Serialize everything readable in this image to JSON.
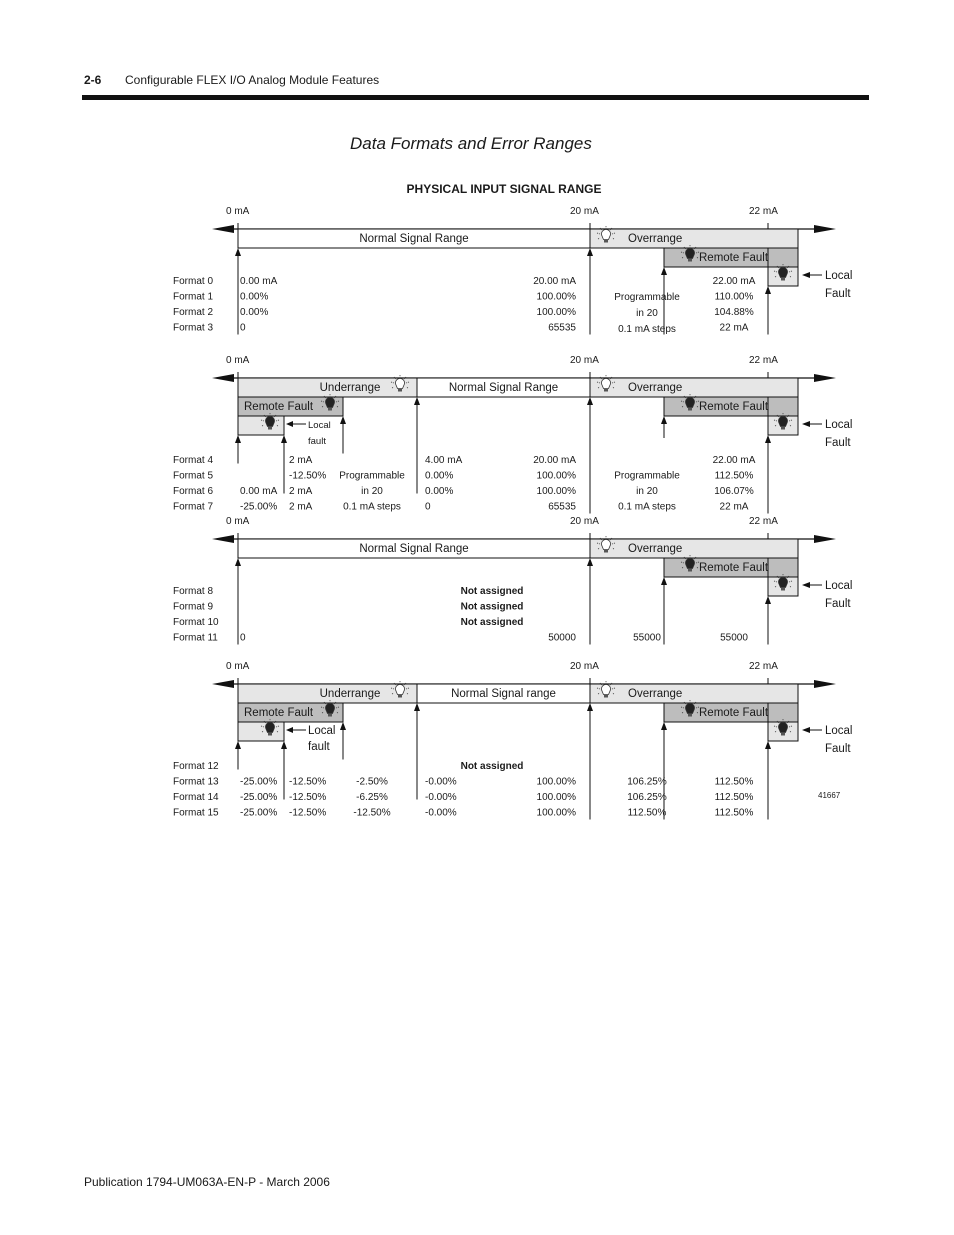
{
  "header": {
    "page_number": "2-6",
    "chapter_title": "Configurable FLEX I/O Analog Module Features"
  },
  "figure": {
    "title": "Data Formats and Error Ranges",
    "subtitle": "PHYSICAL INPUT SIGNAL RANGE",
    "figure_id": "41667"
  },
  "footer": {
    "publication": "Publication 1794-UM063A-EN-P - March 2006"
  },
  "colors": {
    "light_fill": "#e6e6e6",
    "dark_fill": "#bdbdbd",
    "line": "#111111"
  },
  "panels": [
    {
      "axis_labels": [
        "0 mA",
        "20 mA",
        "22 mA"
      ],
      "underrange": null,
      "normal_label": "Normal Signal Range",
      "overrange_label": "Overrange",
      "remote_fault_label": "Remote Fault",
      "local_fault_label": [
        "Local",
        "Fault"
      ],
      "formats": [
        "Format 0",
        "Format 1",
        "Format 2",
        "Format 3"
      ],
      "columns": [
        {
          "pos": "zero",
          "values": [
            "0.00 mA",
            "0.00%",
            "0.00%",
            "0"
          ]
        },
        {
          "pos": "normal_end",
          "values": [
            "20.00 mA",
            "100.00%",
            "100.00%",
            "65535"
          ]
        },
        {
          "pos": "remote_start",
          "values": [
            "Programmable",
            "in 20",
            "0.1 mA steps"
          ]
        },
        {
          "pos": "local_start",
          "values": [
            "22.00 mA",
            "110.00%",
            "104.88%",
            "22 mA"
          ]
        }
      ]
    },
    {
      "axis_labels": [
        "0 mA",
        "20 mA",
        "22 mA"
      ],
      "underrange": {
        "label": "Underrange",
        "remote_fault_label": "Remote Fault",
        "local_fault_label": [
          "Local",
          "fault"
        ]
      },
      "normal_label": "Normal Signal Range",
      "overrange_label": "Overrange",
      "remote_fault_label": "Remote Fault",
      "local_fault_label": [
        "Local",
        "Fault"
      ],
      "formats": [
        "Format 4",
        "Format 5",
        "Format 6",
        "Format 7"
      ],
      "columns": [
        {
          "pos": "zero",
          "values": [
            "",
            "",
            "0.00 mA",
            "-25.00%"
          ]
        },
        {
          "pos": "u_local_end",
          "values": [
            "2 mA",
            "-12.50%",
            "2 mA",
            "2 mA"
          ]
        },
        {
          "pos": "u_remote_end",
          "values": [
            "",
            "Programmable",
            "in 20",
            "0.1 mA steps"
          ]
        },
        {
          "pos": "normal_start",
          "values": [
            "4.00 mA",
            "0.00%",
            "0.00%",
            "0"
          ]
        },
        {
          "pos": "normal_end",
          "values": [
            "20.00 mA",
            "100.00%",
            "100.00%",
            "65535"
          ]
        },
        {
          "pos": "remote_start",
          "values": [
            "",
            "Programmable",
            "in 20",
            "0.1 mA steps"
          ]
        },
        {
          "pos": "local_start",
          "values": [
            "22.00 mA",
            "112.50%",
            "106.07%",
            "22 mA"
          ]
        }
      ]
    },
    {
      "axis_labels": [
        "0 mA",
        "20 mA",
        "22 mA"
      ],
      "underrange": null,
      "normal_label": "Normal Signal Range",
      "overrange_label": "Overrange",
      "remote_fault_label": "Remote Fault",
      "local_fault_label": [
        "Local",
        "Fault"
      ],
      "formats": [
        "Format 8",
        "Format 9",
        "Format 10",
        "Format 11"
      ],
      "not_assigned": [
        "Not assigned",
        "Not assigned",
        "Not assigned"
      ],
      "columns": [
        {
          "pos": "zero",
          "values": [
            "",
            "",
            "",
            "0"
          ]
        },
        {
          "pos": "normal_end",
          "values": [
            "",
            "",
            "",
            "50000"
          ]
        },
        {
          "pos": "remote_start",
          "values": [
            "",
            "",
            "",
            "55000"
          ]
        },
        {
          "pos": "local_start",
          "values": [
            "",
            "",
            "",
            "55000"
          ]
        }
      ]
    },
    {
      "axis_labels": [
        "0 mA",
        "20 mA",
        "22 mA"
      ],
      "underrange": {
        "label": "Underrange",
        "remote_fault_label": "Remote Fault",
        "local_fault_label": [
          "Local",
          "fault"
        ]
      },
      "normal_label": "Normal Signal range",
      "overrange_label": "Overrange",
      "remote_fault_label": "Remote Fault",
      "local_fault_label": [
        "Local",
        "Fault"
      ],
      "formats": [
        "Format 12",
        "Format 13",
        "Format 14",
        "Format 15"
      ],
      "not_assigned": [
        "Not assigned"
      ],
      "columns": [
        {
          "pos": "zero",
          "values": [
            "",
            "-25.00%",
            "-25.00%",
            "-25.00%"
          ]
        },
        {
          "pos": "u_local_end",
          "values": [
            "",
            "-12.50%",
            "-12.50%",
            "-12.50%"
          ]
        },
        {
          "pos": "u_remote_end",
          "values": [
            "",
            "-2.50%",
            "-6.25%",
            "-12.50%"
          ]
        },
        {
          "pos": "normal_start",
          "values": [
            "",
            "-0.00%",
            "-0.00%",
            "-0.00%"
          ]
        },
        {
          "pos": "normal_end",
          "values": [
            "",
            "100.00%",
            "100.00%",
            "100.00%"
          ]
        },
        {
          "pos": "remote_start",
          "values": [
            "",
            "106.25%",
            "106.25%",
            "112.50%"
          ]
        },
        {
          "pos": "local_start",
          "values": [
            "",
            "112.50%",
            "112.50%",
            "112.50%"
          ]
        }
      ]
    }
  ]
}
